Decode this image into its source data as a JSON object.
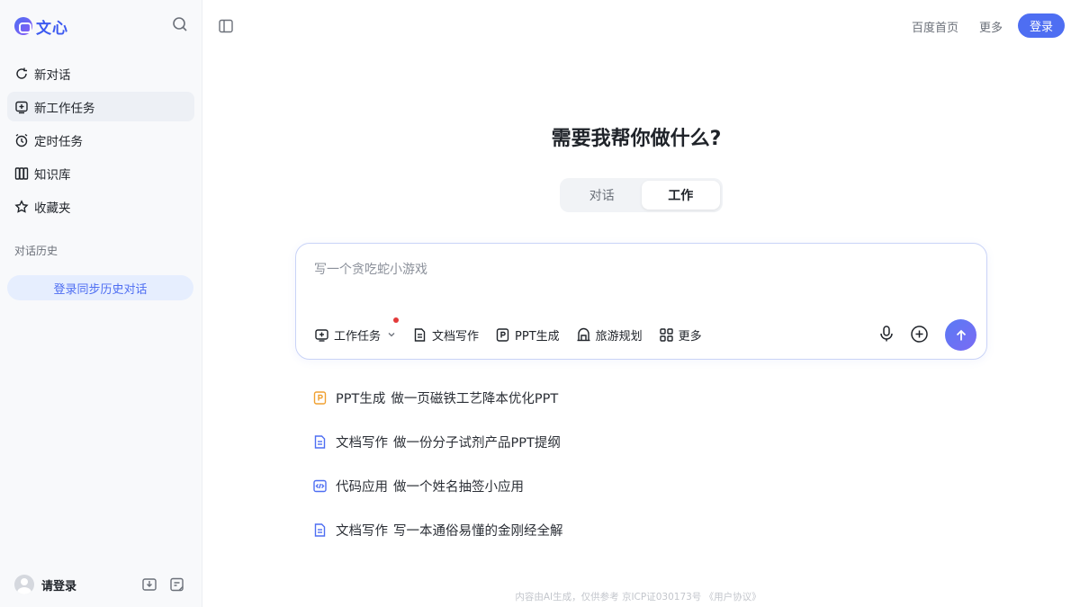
{
  "sidebar": {
    "brand": "文心",
    "items": [
      {
        "label": "新对话",
        "icon": "new-chat-icon"
      },
      {
        "label": "新工作任务",
        "icon": "add-task-icon",
        "active": true
      },
      {
        "label": "定时任务",
        "icon": "alarm-clock-icon"
      },
      {
        "label": "知识库",
        "icon": "books-icon"
      },
      {
        "label": "收藏夹",
        "icon": "star-icon"
      }
    ],
    "history_label": "对话历史",
    "login_sync": "登录同步历史对话",
    "footer_login": "请登录"
  },
  "header": {
    "links": [
      "百度首页",
      "更多"
    ],
    "login_button": "登录"
  },
  "main": {
    "headline": "需要我帮你做什么?",
    "modes": [
      "对话",
      "工作"
    ],
    "active_mode": "工作",
    "composer": {
      "placeholder": "写一个贪吃蛇小游戏",
      "tools": [
        {
          "label": "工作任务",
          "icon": "add-task-icon"
        },
        {
          "label": "文档写作",
          "icon": "document-icon"
        },
        {
          "label": "PPT生成",
          "icon": "ppt-icon"
        },
        {
          "label": "旅游规划",
          "icon": "travel-icon"
        },
        {
          "label": "更多",
          "icon": "grid-icon"
        }
      ]
    },
    "suggestions": [
      {
        "tag": "PPT生成",
        "text": "做一页磁铁工艺降本优化PPT",
        "icon": "ppt-icon",
        "color": "#f0a030"
      },
      {
        "tag": "文档写作",
        "text": "做一份分子试剂产品PPT提纲",
        "icon": "document-icon",
        "color": "#4e6ef2"
      },
      {
        "tag": "代码应用",
        "text": "做一个姓名抽签小应用",
        "icon": "code-icon",
        "color": "#4e6ef2"
      },
      {
        "tag": "文档写作",
        "text": "写一本通俗易懂的金刚经全解",
        "icon": "document-icon",
        "color": "#4e6ef2"
      }
    ],
    "disclaimer": "内容由AI生成，仅供参考  京ICP证030173号  《用户协议》"
  },
  "colors": {
    "accent": "#4e6ef2",
    "sidebar_bg": "#f8f9fb"
  }
}
